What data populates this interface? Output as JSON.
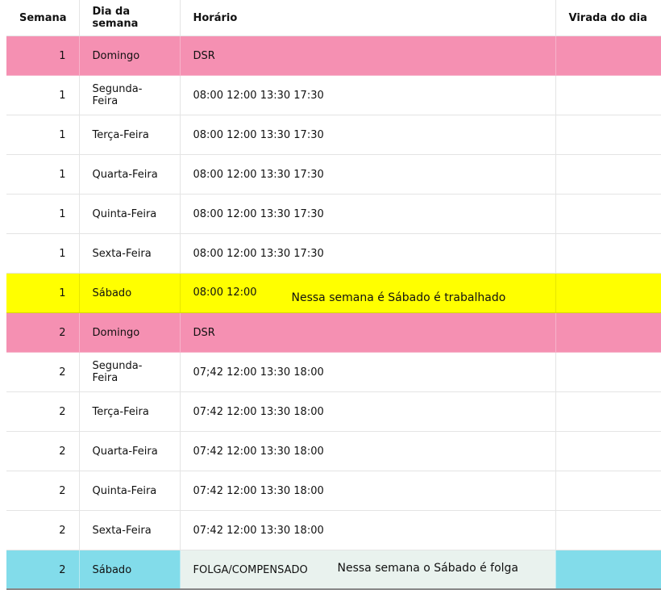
{
  "headers": {
    "semana": "Semana",
    "dia": "Dia da semana",
    "horario": "Horário",
    "virada": "Virada do dia"
  },
  "rows": [
    {
      "semana": "1",
      "dia": "Domingo",
      "horario": "DSR",
      "virada": ""
    },
    {
      "semana": "1",
      "dia": "Segunda-Feira",
      "horario": "08:00 12:00 13:30 17:30",
      "virada": ""
    },
    {
      "semana": "1",
      "dia": "Terça-Feira",
      "horario": "08:00 12:00 13:30 17:30",
      "virada": ""
    },
    {
      "semana": "1",
      "dia": "Quarta-Feira",
      "horario": "08:00 12:00 13:30 17:30",
      "virada": ""
    },
    {
      "semana": "1",
      "dia": "Quinta-Feira",
      "horario": "08:00 12:00 13:30 17:30",
      "virada": ""
    },
    {
      "semana": "1",
      "dia": "Sexta-Feira",
      "horario": "08:00 12:00 13:30 17:30",
      "virada": ""
    },
    {
      "semana": "1",
      "dia": "Sábado",
      "horario": "08:00 12:00",
      "virada": "",
      "note": "Nessa semana é Sábado é trabalhado"
    },
    {
      "semana": "2",
      "dia": "Domingo",
      "horario": "DSR",
      "virada": ""
    },
    {
      "semana": "2",
      "dia": "Segunda-Feira",
      "horario": "07;42 12:00 13:30 18:00",
      "virada": ""
    },
    {
      "semana": "2",
      "dia": "Terça-Feira",
      "horario": "07:42 12:00 13:30 18:00",
      "virada": ""
    },
    {
      "semana": "2",
      "dia": "Quarta-Feira",
      "horario": "07:42 12:00 13:30 18:00",
      "virada": ""
    },
    {
      "semana": "2",
      "dia": "Quinta-Feira",
      "horario": "07:42 12:00 13:30 18:00",
      "virada": ""
    },
    {
      "semana": "2",
      "dia": "Sexta-Feira",
      "horario": "07:42 12:00 13:30 18:00",
      "virada": ""
    },
    {
      "semana": "2",
      "dia": "Sábado",
      "horario": "FOLGA/COMPENSADO",
      "virada": "",
      "note": "Nessa semana o Sábado é folga"
    }
  ],
  "colors": {
    "dsr_row": "#f590b2",
    "saturday_worked": "#ffff00",
    "saturday_off": "#82dcea",
    "saturday_off_horario": "#e9f2ee"
  }
}
